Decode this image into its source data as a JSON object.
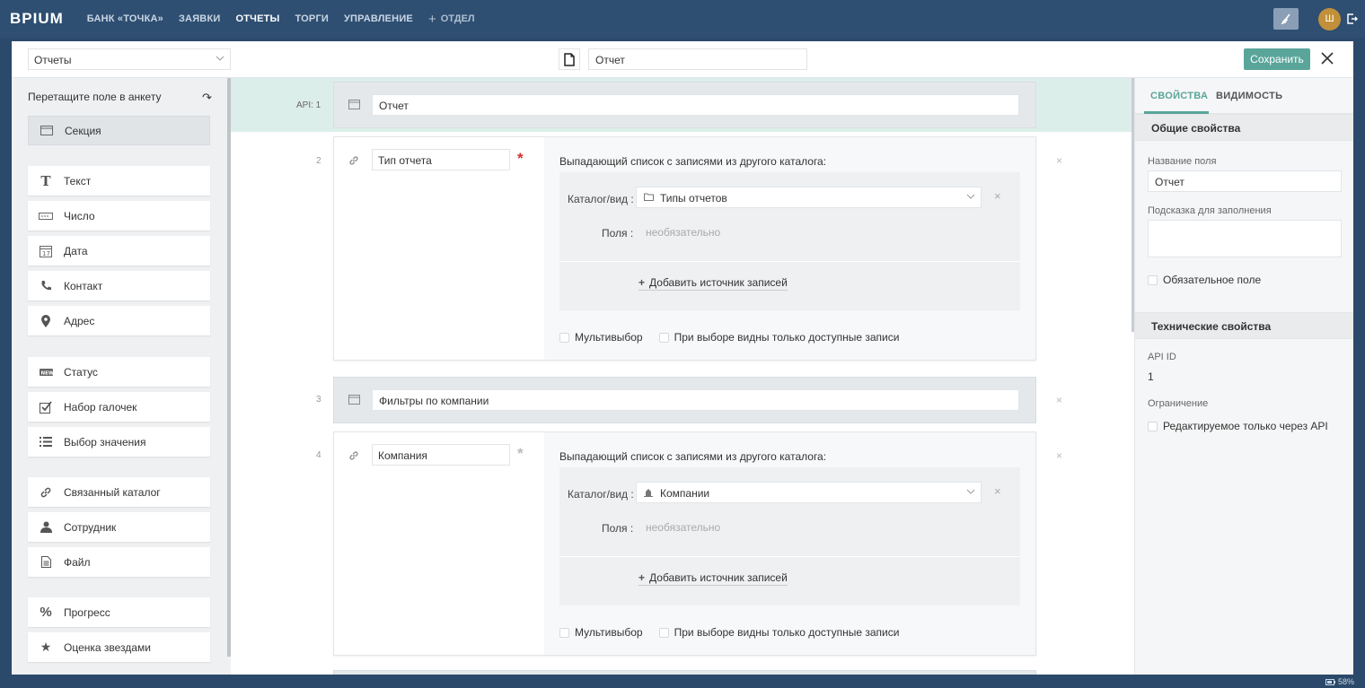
{
  "nav": {
    "logo": "BPIUM",
    "items": [
      "БАНК «ТОЧКА»",
      "ЗАЯВКИ",
      "ОТЧЕТЫ",
      "ТОРГИ",
      "УПРАВЛЕНИЕ"
    ],
    "active_index": 2,
    "add_label": "ОТДЕЛ",
    "avatar_initial": "Ш"
  },
  "toolbar": {
    "catalog_select": "Отчеты",
    "catalog_name": "Отчет",
    "save_label": "Сохранить"
  },
  "palette": {
    "header": "Перетащите поле в анкету",
    "items": [
      {
        "label": "Секция",
        "icon": "section-icon"
      },
      {
        "label": "Текст",
        "icon": "text-icon"
      },
      {
        "label": "Число",
        "icon": "number-icon"
      },
      {
        "label": "Дата",
        "icon": "calendar-icon"
      },
      {
        "label": "Контакт",
        "icon": "phone-icon"
      },
      {
        "label": "Адрес",
        "icon": "map-pin-icon"
      },
      {
        "label": "Статус",
        "icon": "status-icon"
      },
      {
        "label": "Набор галочек",
        "icon": "checkbox-icon"
      },
      {
        "label": "Выбор значения",
        "icon": "list-icon"
      },
      {
        "label": "Связанный каталог",
        "icon": "link-icon"
      },
      {
        "label": "Сотрудник",
        "icon": "user-icon"
      },
      {
        "label": "Файл",
        "icon": "file-icon"
      },
      {
        "label": "Прогресс",
        "icon": "percent-icon"
      },
      {
        "label": "Оценка звездами",
        "icon": "star-icon"
      }
    ]
  },
  "canvas": {
    "api_label": "API: 1",
    "section1": {
      "value": "Отчет"
    },
    "field2": {
      "num": "2",
      "name": "Тип отчета",
      "required": true,
      "title": "Выпадающий список с записями из другого каталога:",
      "catalog_label": "Каталог/вид :",
      "catalog_value": "Типы отчетов",
      "fields_label": "Поля :",
      "fields_placeholder": "необязательно",
      "add_source": "Добавить источник записей",
      "multiselect": "Мультивыбор",
      "only_available": "При выборе видны только доступные записи"
    },
    "section3": {
      "num": "3",
      "value": "Фильтры по компании"
    },
    "field4": {
      "num": "4",
      "name": "Компания",
      "required": false,
      "title": "Выпадающий список с записями из другого каталога:",
      "catalog_label": "Каталог/вид :",
      "catalog_value": "Компании",
      "fields_label": "Поля :",
      "fields_placeholder": "необязательно",
      "add_source": "Добавить источник записей",
      "multiselect": "Мультивыбор",
      "only_available": "При выборе видны только доступные записи"
    }
  },
  "props": {
    "tab_properties": "СВОЙСТВА",
    "tab_visibility": "ВИДИМОСТЬ",
    "general_header": "Общие свойства",
    "field_name_label": "Название поля",
    "field_name_value": "Отчет",
    "hint_label": "Подсказка для заполнения",
    "required_label": "Обязательное поле",
    "tech_header": "Технические свойства",
    "api_id_label": "API ID",
    "api_id_value": "1",
    "restriction_label": "Ограничение",
    "api_only_label": "Редактируемое только через API"
  },
  "status": {
    "battery": "58%"
  },
  "colors": {
    "accent": "#5aa59a",
    "required": "#d0312d",
    "nav_bg": "#2e4f72"
  }
}
